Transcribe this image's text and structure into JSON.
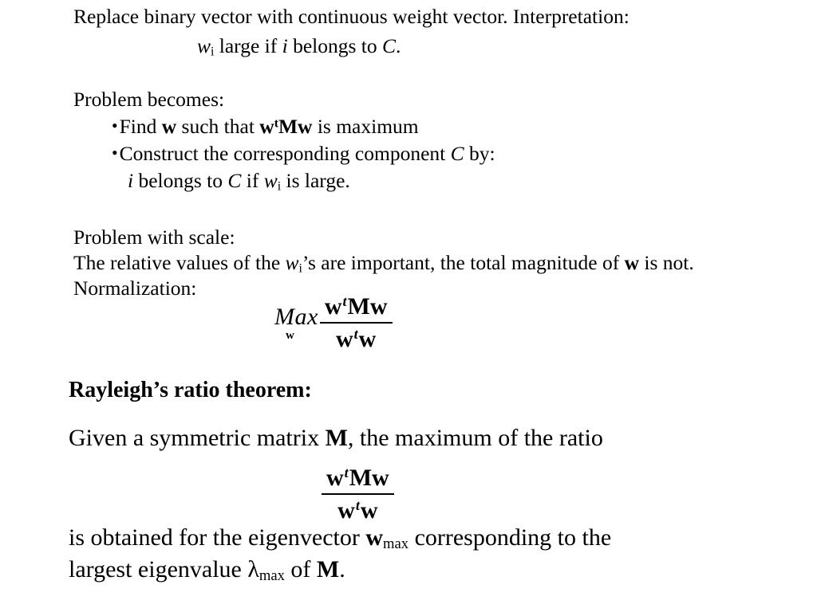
{
  "slide": {
    "background_color": "#ffffff",
    "text_color": "#000000",
    "intro": {
      "line1": "Replace binary vector with continuous weight vector. Interpretation:",
      "line2_prefix": "w",
      "line2_sub": "i",
      "line2_mid": " large if ",
      "line2_italic_i": "i",
      "line2_mid2": " belongs to ",
      "line2_italic_c": "C",
      "line2_end": "."
    },
    "problem": {
      "heading": "Problem becomes:",
      "bullet_char": "•",
      "bullet1": {
        "pre": "Find ",
        "w1": "w",
        "mid": " such that ",
        "w2": "w",
        "sup_t": "t",
        "m": "M",
        "w3": "w",
        "post": " is maximum"
      },
      "bullet2": {
        "pre": "Construct the corresponding component ",
        "c": "C",
        "post": " by:"
      },
      "bullet2_cont": {
        "i": "i",
        "mid": " belongs to ",
        "c": "C",
        "mid2": " if ",
        "w": "w",
        "w_sub": "i",
        "post": " is large."
      }
    },
    "scale": {
      "heading": "Problem with scale:",
      "line_a_pre": "The relative values of the ",
      "line_a_w": "w",
      "line_a_sub": "i",
      "line_a_mid": "’s are important, the total magnitude of ",
      "line_a_w2": "w",
      "line_a_end": " is not.",
      "normalization": "Normalization:"
    },
    "equation1": {
      "operator": "Max",
      "operator_sub": "w",
      "numerator": {
        "w1": "w",
        "sup_t": "t",
        "m": "M",
        "w2": "w"
      },
      "denominator": {
        "w1": "w",
        "sup_t": "t",
        "w2": "w"
      }
    },
    "rayleigh": {
      "heading": "Rayleigh’s ratio theorem:",
      "given_pre": "Given a symmetric matrix ",
      "given_m": "M",
      "given_post": ", the maximum of the ratio"
    },
    "equation2": {
      "numerator": {
        "w1": "w",
        "sup_t": "t",
        "m": "M",
        "w2": "w"
      },
      "denominator": {
        "w1": "w",
        "sup_t": "t",
        "w2": "w"
      }
    },
    "conclusion": {
      "line1_pre": "is obtained for the eigenvector ",
      "line1_w": "w",
      "line1_sub": "max",
      "line1_post": " corresponding to the",
      "line2_pre": "largest eigenvalue ",
      "line2_lambda": "λ",
      "line2_sub": "max",
      "line2_mid": " of ",
      "line2_m": "M",
      "line2_end": "."
    }
  }
}
